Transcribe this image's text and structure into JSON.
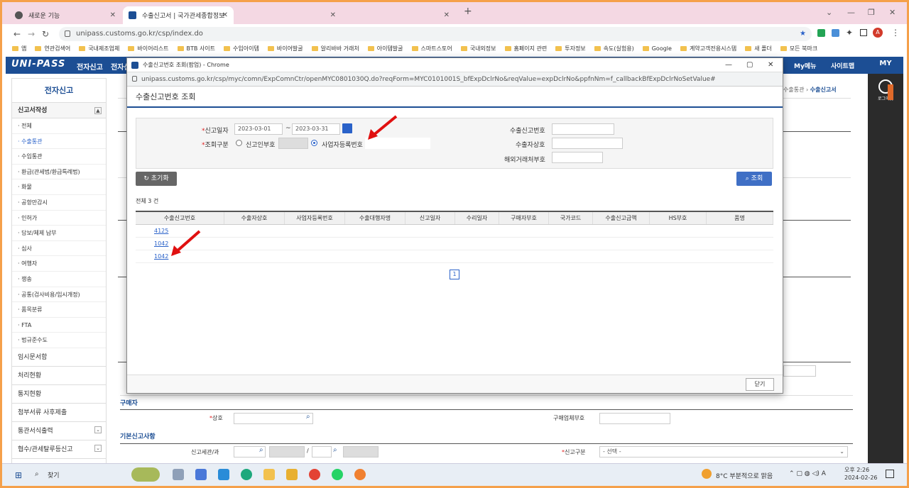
{
  "browser": {
    "tabs": [
      {
        "title": "새로운 기능",
        "active": false
      },
      {
        "title": "수출신고서 | 국가관세종합정보",
        "active": true
      },
      {
        "title": "",
        "active": false
      },
      {
        "title": "",
        "active": false
      }
    ],
    "url": "unipass.customs.go.kr/csp/index.do",
    "bookmarks": [
      "앱",
      "연관검색어",
      "국내제조업체",
      "바이어리스트",
      "BTB 사이트",
      "수입아이템",
      "바이어발굴",
      "알리바바 거래처",
      "아이템발굴",
      "스마트스토어",
      "국내외정보",
      "홈페이지 관련",
      "투자정보",
      "속도(실험용)",
      "Google",
      "계약고객전용시스템",
      "새 폴더",
      "모든 북마크"
    ]
  },
  "site": {
    "logo": "UNI-PASS",
    "menu": [
      "전자신고",
      "전자신"
    ],
    "my_menu": "My메뉴",
    "sitemap": "사이트맵",
    "my": "MY",
    "logout": "로그아웃",
    "breadcrumb": [
      "수출통관",
      "수출신고서"
    ]
  },
  "sidebar": {
    "title": "전자신고",
    "section": "신고서작성",
    "items": [
      "전체",
      "수출통관",
      "수입통관",
      "환급(관세법/환급특례법)",
      "화물",
      "공항만감시",
      "인허가",
      "담보/체제 납부",
      "심사",
      "여행자",
      "쟁송",
      "공통(검사비용/임시개정)",
      "품목분류",
      "FTA",
      "법규준수도"
    ],
    "active_index": 1,
    "big": [
      "임시문서함",
      "처리현황",
      "통지현황",
      "첨부서류 사후제출",
      "통관서식출력",
      "협수/관세탈루등신고"
    ]
  },
  "popup": {
    "window_title": "수출신고번호 조회(팝업) - Chrome",
    "url": "unipass.customs.go.kr/csp/myc/comn/ExpComnCtr/openMYC0801030Q.do?reqForm=MYC0101001S_bfExpDclrNo&reqValue=expDclrNo&ppfnNm=f_callbackBfExpDclrNoSetValue#",
    "heading": "수출신고번호 조회",
    "form": {
      "date_label": "신고일자",
      "date_from": "2023-03-01",
      "date_sep": "~",
      "date_to": "2023-03-31",
      "type_label": "조회구분",
      "radio1": "신고인부호",
      "radio2": "사업자등록번호",
      "exp_no_label": "수출신고번호",
      "exporter_label": "수출자상호",
      "overseas_label": "해외거래처부호"
    },
    "reset_label": "초기화",
    "search_label": "조회",
    "total": "전체 3 건",
    "columns": [
      "수출신고번호",
      "수출자상호",
      "사업자등록번호",
      "수출대행자명",
      "신고일자",
      "수리일자",
      "구매자부호",
      "국가코드",
      "수출신고금액",
      "HS부호",
      "품명"
    ],
    "rows": [
      {
        "no": "4125"
      },
      {
        "no": "1042"
      },
      {
        "no": "1042"
      }
    ],
    "page": "1",
    "close_label": "닫기"
  },
  "lower": {
    "buyer_section": "구매자",
    "name_label": "상호",
    "buyer_code_label": "구매업체부호",
    "basic_section": "기본신고사항",
    "customs_label": "신고세관/과",
    "slash": "/",
    "type_label": "신고구분",
    "select_value": "- 선택 -"
  },
  "taskbar": {
    "search": "찾기",
    "weather": "8°C  부분적으로 맑음",
    "time": "오후 2:26",
    "date": "2024-02-26"
  },
  "colors": {
    "accent": "#1c4e94",
    "link": "#2a62c9",
    "arrow": "#e01010",
    "frame": "#f5a04a"
  }
}
